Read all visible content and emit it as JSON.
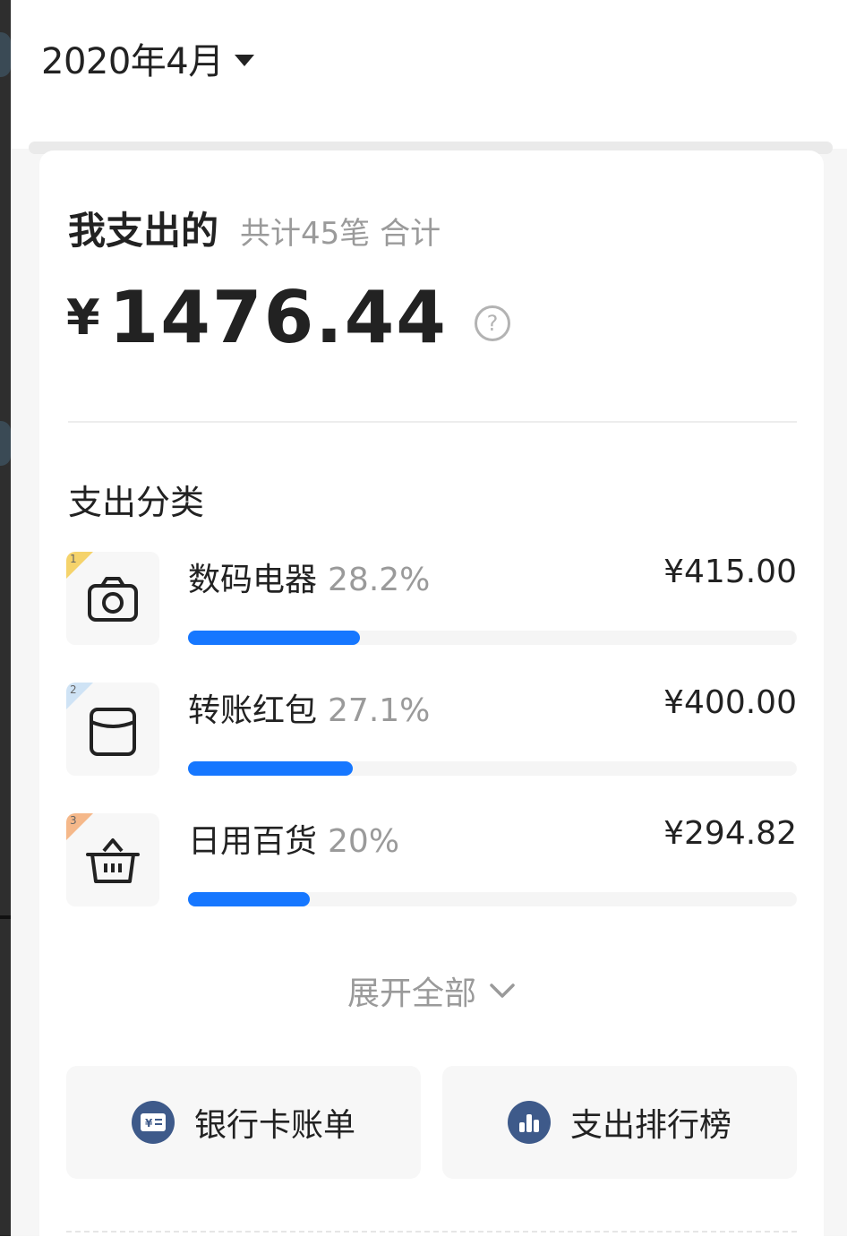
{
  "header": {
    "month": "2020年4月"
  },
  "summary": {
    "title": "我支出的",
    "count_text": "共计45笔 合计",
    "currency": "¥",
    "total": "1476.44",
    "help_glyph": "?"
  },
  "categories": {
    "title": "支出分类",
    "items": [
      {
        "rank": "1",
        "name": "数码电器",
        "percent": "28.2%",
        "amount": "¥415.00",
        "icon": "camera-icon",
        "badge_color": "#f5d36b",
        "bar_fraction": 0.282
      },
      {
        "rank": "2",
        "name": "转账红包",
        "percent": "27.1%",
        "amount": "¥400.00",
        "icon": "envelope-icon",
        "badge_color": "#cfe3f5",
        "bar_fraction": 0.271
      },
      {
        "rank": "3",
        "name": "日用百货",
        "percent": "20%",
        "amount": "¥294.82",
        "icon": "basket-icon",
        "badge_color": "#f5b88a",
        "bar_fraction": 0.2
      }
    ],
    "expand_label": "展开全部"
  },
  "actions": {
    "bank_bill": {
      "label": "银行卡账单",
      "icon": "bank-card-icon"
    },
    "ranking": {
      "label": "支出排行榜",
      "icon": "bar-chart-icon"
    }
  },
  "colors": {
    "accent": "#1677ff",
    "muted_text": "#9a9a9a",
    "action_icon_bg": "#3e5a8a"
  }
}
